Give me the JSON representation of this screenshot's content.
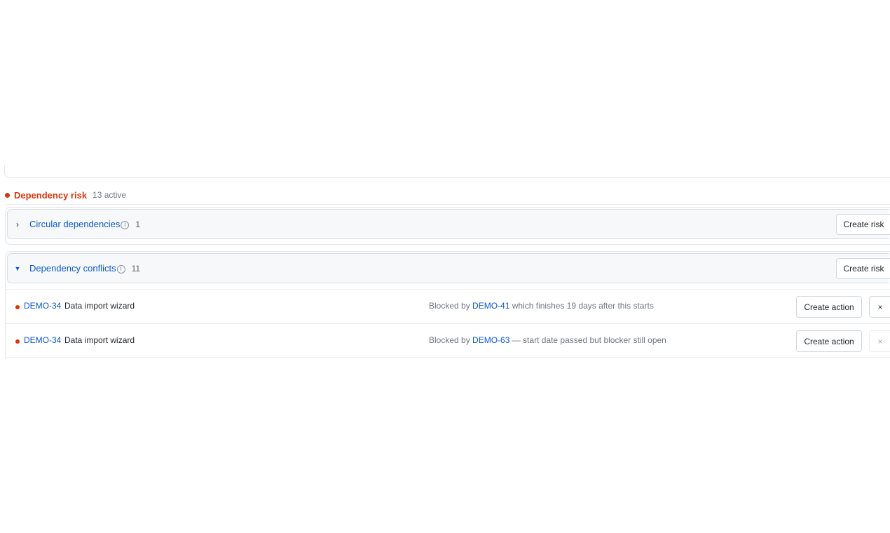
{
  "risk_section": {
    "title": "Dependency risk",
    "count_label": "13 active",
    "accent_color": "#d9360b"
  },
  "groups": [
    {
      "title": "Circular dependencies",
      "expanded": false,
      "chevron_icon": "chevron-right-icon",
      "chevron": "›",
      "info_icon": "ⓘ",
      "count": "1",
      "create_label": "Create risk"
    },
    {
      "title": "Dependency conflicts",
      "expanded": true,
      "chevron_icon": "triangle-down-icon",
      "chevron": "▼",
      "info_icon": "ⓘ",
      "count": "11",
      "create_label": "Create risk",
      "rows": [
        {
          "key": "DEMO-34",
          "title": "Data import wizard",
          "reason_prefix": "Blocked by ",
          "blocker_key": "DEMO-41",
          "reason_suffix": " which finishes 19 days after this starts",
          "action_label": "Create action",
          "dismiss_label": "×"
        },
        {
          "key": "DEMO-34",
          "title": "Data import wizard",
          "reason_prefix": "Blocked by ",
          "blocker_key": "DEMO-63",
          "reason_suffix": " — start date passed but blocker still open",
          "action_label": "Create action",
          "dismiss_label": "×"
        }
      ]
    }
  ]
}
